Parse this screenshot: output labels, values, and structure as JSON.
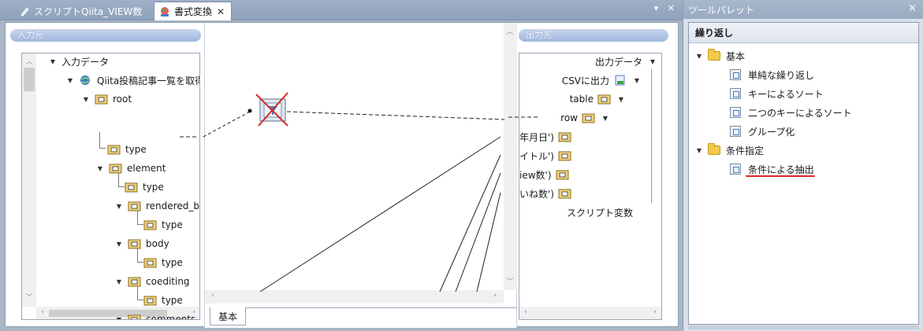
{
  "tabs": [
    {
      "label": "スクリプトQiita_VIEW数",
      "active": false
    },
    {
      "label": "書式変換",
      "active": true
    }
  ],
  "tabbar_controls": "▾ ✕",
  "input": {
    "header": "入力元",
    "tree": [
      {
        "label": "入力データ",
        "level": 0,
        "icon": "none"
      },
      {
        "label": "Qiita投稿記事一覧を取得",
        "level": 1,
        "icon": "globe-icon"
      },
      {
        "label": "root",
        "level": 2,
        "icon": "node-icon"
      },
      {
        "label": "type",
        "level": 3,
        "icon": "leaf-icon"
      },
      {
        "label": "element",
        "level": 3,
        "icon": "node-icon"
      },
      {
        "label": "type",
        "level": 4,
        "icon": "leaf-icon"
      },
      {
        "label": "rendered_bo",
        "level": 4,
        "icon": "node-icon"
      },
      {
        "label": "type",
        "level": 5,
        "icon": "leaf-icon"
      },
      {
        "label": "body",
        "level": 4,
        "icon": "node-icon"
      },
      {
        "label": "type",
        "level": 5,
        "icon": "leaf-icon"
      },
      {
        "label": "coediting",
        "level": 4,
        "icon": "node-icon"
      },
      {
        "label": "type",
        "level": 5,
        "icon": "leaf-icon"
      },
      {
        "label": "comments_c",
        "level": 4,
        "icon": "node-icon"
      }
    ]
  },
  "output": {
    "header": "出力先",
    "tree": [
      {
        "label": "出力データ"
      },
      {
        "label": "CSVに出力"
      },
      {
        "label": "table"
      },
      {
        "label": "row"
      },
      {
        "label": "年月日')"
      },
      {
        "label": "イトル')"
      },
      {
        "label": "iew数')"
      },
      {
        "label": "いね数')"
      },
      {
        "label": "スクリプト変数"
      }
    ]
  },
  "canvas": {
    "tab_label": "基本"
  },
  "palette": {
    "title": "ツールパレット",
    "close": "×",
    "section": "繰り返し",
    "groups": [
      {
        "label": "基本",
        "items": [
          "単純な繰り返し",
          "キーによるソート",
          "二つのキーによるソート",
          "グループ化"
        ]
      },
      {
        "label": "条件指定",
        "items": [
          "条件による抽出"
        ]
      }
    ],
    "highlight_color": "#d62828"
  }
}
